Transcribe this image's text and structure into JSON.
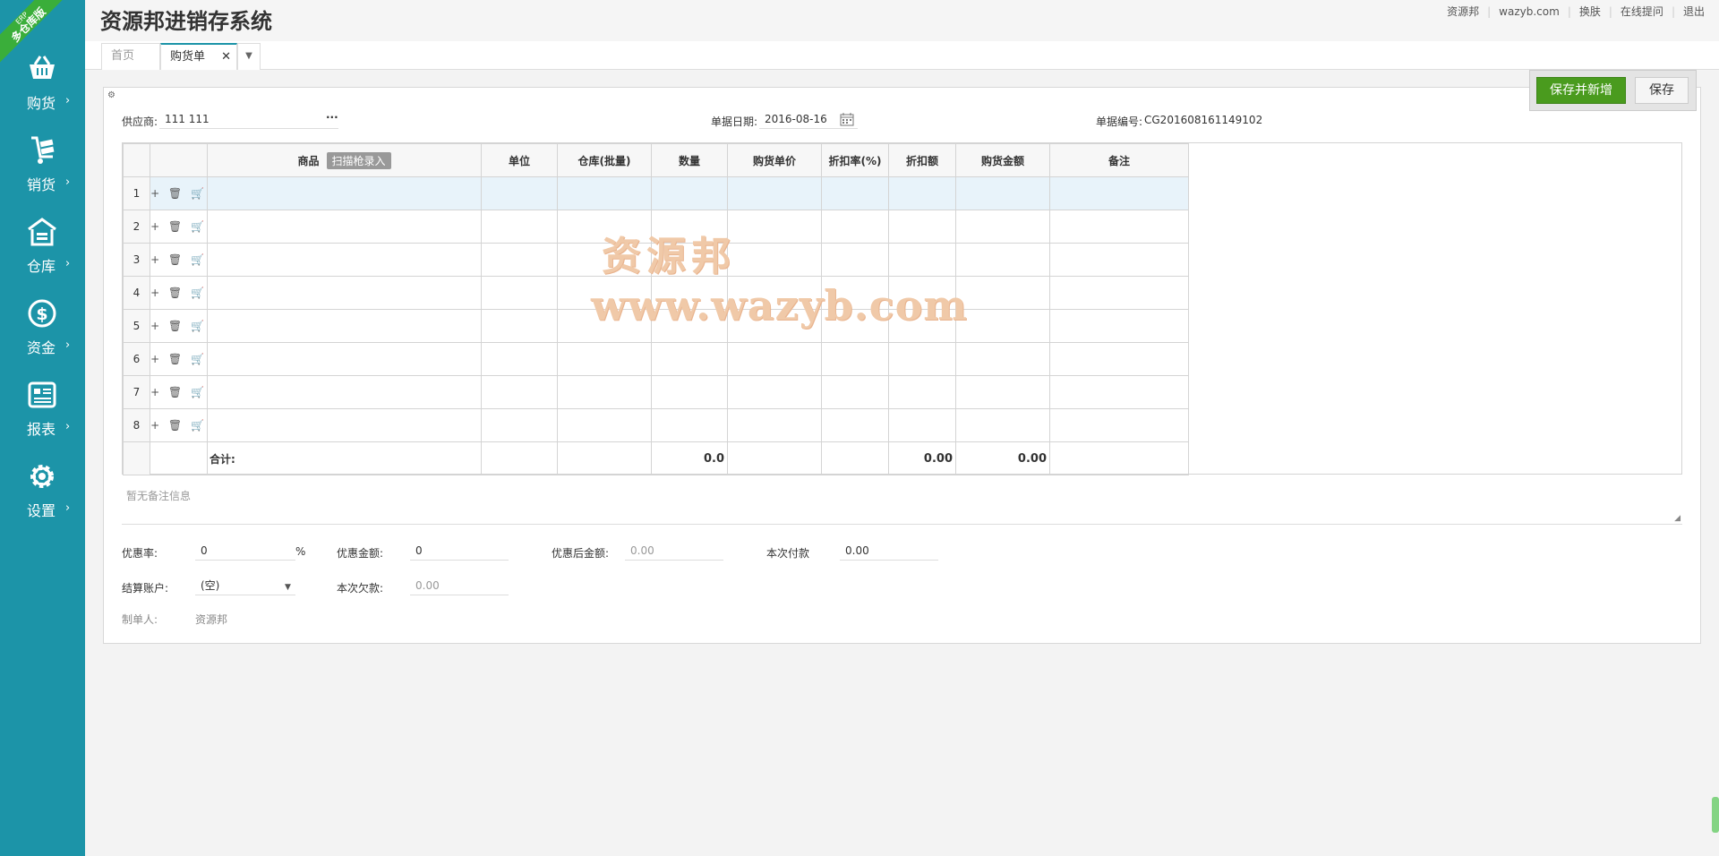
{
  "app": {
    "title": "资源邦进销存系统",
    "ribbon_top": "ERP",
    "ribbon_bottom": "多仓库版"
  },
  "top_links": [
    "资源邦",
    "wazyb.com",
    "换肤",
    "在线提问",
    "退出"
  ],
  "sidebar": {
    "items": [
      {
        "label": "购货",
        "icon": "basket-icon"
      },
      {
        "label": "销货",
        "icon": "hand-truck-icon"
      },
      {
        "label": "仓库",
        "icon": "warehouse-icon"
      },
      {
        "label": "资金",
        "icon": "dollar-icon"
      },
      {
        "label": "报表",
        "icon": "report-icon"
      },
      {
        "label": "设置",
        "icon": "gear-icon"
      }
    ],
    "arrow": "›"
  },
  "tabs": {
    "home": "首页",
    "active": "购货单",
    "close": "✕",
    "more": "▼"
  },
  "actions": {
    "save_new": "保存并新增",
    "save": "保存"
  },
  "form": {
    "supplier_label": "供应商:",
    "supplier_value": "111 111",
    "supplier_more": "···",
    "date_label": "单据日期:",
    "date_value": "2016-08-16",
    "billno_label": "单据编号:",
    "billno_value": "CG201608161149102"
  },
  "grid": {
    "columns": [
      "商品",
      "单位",
      "仓库(批量)",
      "数量",
      "购货单价",
      "折扣率(%)",
      "折扣额",
      "购货金额",
      "备注"
    ],
    "scan_label": "扫描枪录入",
    "rows": [
      "1",
      "2",
      "3",
      "4",
      "5",
      "6",
      "7",
      "8"
    ],
    "row_ops": "+ 🗑 🛒",
    "total_label": "合计:",
    "total_qty": "0.0",
    "total_discount": "0.00",
    "total_amount": "0.00"
  },
  "remark_placeholder": "暂无备注信息",
  "footer": {
    "discount_rate_label": "优惠率:",
    "discount_rate_value": "0",
    "percent": "%",
    "discount_amount_label": "优惠金额:",
    "discount_amount_value": "0",
    "after_discount_label": "优惠后金额:",
    "after_discount_value": "0.00",
    "payment_label": "本次付款",
    "payment_value": "0.00",
    "account_label": "结算账户:",
    "account_value": "(空)",
    "arrears_label": "本次欠款:",
    "arrears_value": "0.00",
    "creator_label": "制单人:",
    "creator_value": "资源邦"
  },
  "watermark": {
    "line1": "资源邦",
    "line2": "www.wazyb.com"
  },
  "colors": {
    "sidebar": "#1c94a8",
    "primary_button": "#4a9b1e",
    "ribbon": "#3aae3a"
  }
}
